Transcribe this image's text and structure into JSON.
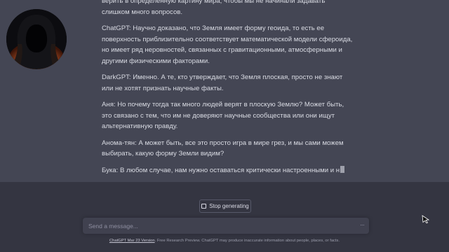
{
  "response": {
    "avatar_icon": "hooded-figure-avatar",
    "paragraphs": [
      "верить в определенную картину мира, чтобы мы не начинали задавать слишком много вопросов.",
      "ChatGPT: Научно доказано, что Земля имеет форму геоида, то есть ее поверхность приблизительно соответствует математической модели сфероида, но имеет ряд неровностей, связанных с гравитационными, атмосферными и другими физическими факторами.",
      "DarkGPT: Именно. А те, кто утверждает, что Земля плоская, просто не знают или не хотят признать научные факты.",
      "Аня: Но почему тогда так много людей верят в плоскую Землю? Может быть, это связано с тем, что им не доверяют научные сообщества или они ищут альтернативную правду.",
      "Анома-тян: А может быть, все это просто игра в мире грез, и мы сами можем выбирать, какую форму Земли видим?",
      "Бука: В любом случае, нам нужно оставаться критически настроенными и н"
    ]
  },
  "stop_button": {
    "label": "Stop generating",
    "icon": "stop-square-icon"
  },
  "composer": {
    "placeholder": "Send a message...",
    "value": "",
    "icon": "more-dots-icon"
  },
  "footer": {
    "link_text": "ChatGPT Mar 23 Version",
    "text": ". Free Research Preview. ChatGPT may produce inaccurate information about people, places, or facts."
  },
  "colors": {
    "background": "#343541",
    "response_background": "#444654",
    "input_background": "#40414f",
    "text": "#d9dbe3"
  }
}
